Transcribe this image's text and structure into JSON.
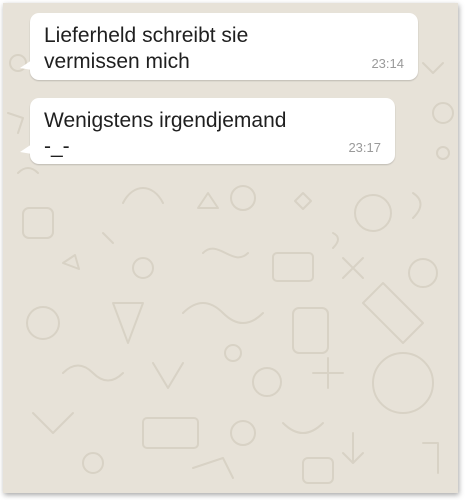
{
  "messages": [
    {
      "text": "Lieferheld schreibt sie\nvermissen mich",
      "time": "23:14"
    },
    {
      "text": "Wenigstens irgendjemand\n-_-",
      "time": "23:17"
    }
  ],
  "colors": {
    "wallpaper": "#e7e2d8",
    "doodle": "#d9d3c7",
    "bubble": "#ffffff",
    "text": "#1f1f1f",
    "timestamp": "#9a9a9a"
  }
}
